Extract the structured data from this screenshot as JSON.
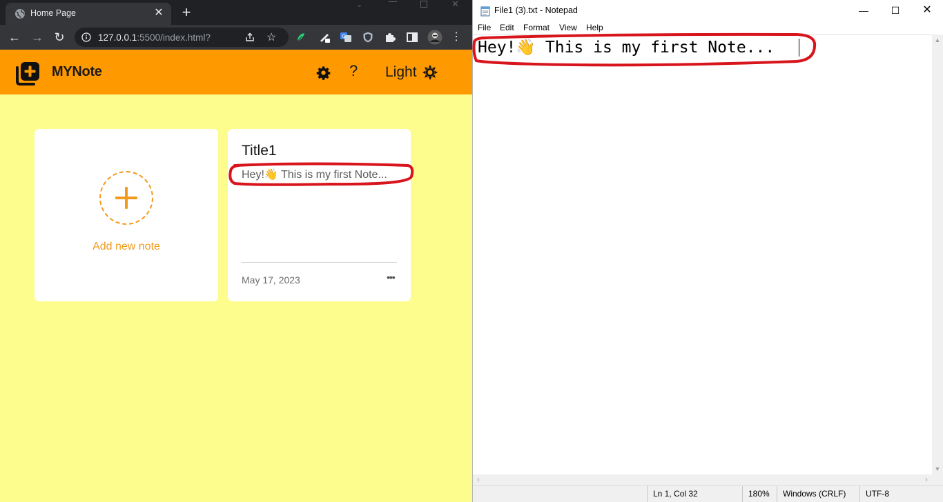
{
  "browser": {
    "tab": {
      "title": "Home Page",
      "favicon": "globe-icon"
    },
    "address": {
      "host": "127.0.0.1",
      "rest": ":5500/index.html?"
    }
  },
  "app": {
    "brand": "MYNote",
    "theme_label": "Light",
    "help_label": "?",
    "accent": "#ff9900",
    "background": "#fdfd8e",
    "add_card": {
      "label": "Add new note"
    },
    "notes": [
      {
        "title": "Title1",
        "body": "Hey!👋 This is my first Note...",
        "date": "May 17, 2023",
        "menu": "•••"
      }
    ]
  },
  "notepad": {
    "window_title": "File1 (3).txt - Notepad",
    "menu": [
      "File",
      "Edit",
      "Format",
      "View",
      "Help"
    ],
    "content": "Hey!👋 This is my first Note...",
    "status": {
      "position": "Ln 1, Col 32",
      "zoom": "180%",
      "line_ending": "Windows (CRLF)",
      "encoding": "UTF-8"
    }
  }
}
